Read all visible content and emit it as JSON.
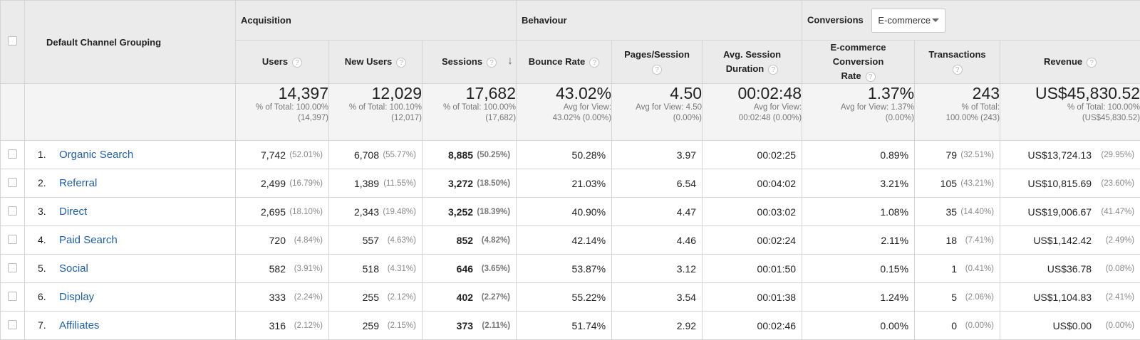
{
  "groups": {
    "dimension": "Default Channel Grouping",
    "acquisition": "Acquisition",
    "behaviour": "Behaviour",
    "conversions": "Conversions",
    "conversion_type": "E-commerce"
  },
  "columns": {
    "users": "Users",
    "new_users": "New Users",
    "sessions": "Sessions",
    "bounce_rate": "Bounce Rate",
    "pages_session": "Pages/Session",
    "avg_session_line1": "Avg. Session",
    "avg_session_line2": "Duration",
    "ecom_rate_line1": "E-commerce Conversion",
    "ecom_rate_line2": "Rate",
    "transactions": "Transactions",
    "revenue": "Revenue"
  },
  "totals": {
    "users": {
      "value": "14,397",
      "l1": "% of Total: 100.00%",
      "l2": "(14,397)"
    },
    "new_users": {
      "value": "12,029",
      "l1": "% of Total: 100.10%",
      "l2": "(12,017)"
    },
    "sessions": {
      "value": "17,682",
      "l1": "% of Total: 100.00%",
      "l2": "(17,682)"
    },
    "bounce_rate": {
      "value": "43.02%",
      "l1": "Avg for View:",
      "l2": "43.02% (0.00%)"
    },
    "pages_session": {
      "value": "4.50",
      "l1": "Avg for View: 4.50",
      "l2": "(0.00%)"
    },
    "avg_duration": {
      "value": "00:02:48",
      "l1": "Avg for View:",
      "l2": "00:02:48 (0.00%)"
    },
    "ecom_rate": {
      "value": "1.37%",
      "l1": "Avg for View: 1.37%",
      "l2": "(0.00%)"
    },
    "transactions": {
      "value": "243",
      "l1": "% of Total:",
      "l2": "100.00% (243)"
    },
    "revenue": {
      "value": "US$45,830.52",
      "l1": "% of Total: 100.00%",
      "l2": "(US$45,830.52)"
    }
  },
  "rows": [
    {
      "rank": "1.",
      "channel": "Organic Search",
      "users": "7,742",
      "users_pct": "(52.01%)",
      "new_users": "6,708",
      "new_users_pct": "(55.77%)",
      "sessions": "8,885",
      "sessions_pct": "(50.25%)",
      "bounce": "50.28%",
      "pages": "3.97",
      "duration": "00:02:25",
      "conv": "0.89%",
      "trans": "79",
      "trans_pct": "(32.51%)",
      "revenue": "US$13,724.13",
      "revenue_pct": "(29.95%)"
    },
    {
      "rank": "2.",
      "channel": "Referral",
      "users": "2,499",
      "users_pct": "(16.79%)",
      "new_users": "1,389",
      "new_users_pct": "(11.55%)",
      "sessions": "3,272",
      "sessions_pct": "(18.50%)",
      "bounce": "21.03%",
      "pages": "6.54",
      "duration": "00:04:02",
      "conv": "3.21%",
      "trans": "105",
      "trans_pct": "(43.21%)",
      "revenue": "US$10,815.69",
      "revenue_pct": "(23.60%)"
    },
    {
      "rank": "3.",
      "channel": "Direct",
      "users": "2,695",
      "users_pct": "(18.10%)",
      "new_users": "2,343",
      "new_users_pct": "(19.48%)",
      "sessions": "3,252",
      "sessions_pct": "(18.39%)",
      "bounce": "40.90%",
      "pages": "4.47",
      "duration": "00:03:02",
      "conv": "1.08%",
      "trans": "35",
      "trans_pct": "(14.40%)",
      "revenue": "US$19,006.67",
      "revenue_pct": "(41.47%)"
    },
    {
      "rank": "4.",
      "channel": "Paid Search",
      "users": "720",
      "users_pct": "(4.84%)",
      "new_users": "557",
      "new_users_pct": "(4.63%)",
      "sessions": "852",
      "sessions_pct": "(4.82%)",
      "bounce": "42.14%",
      "pages": "4.46",
      "duration": "00:02:24",
      "conv": "2.11%",
      "trans": "18",
      "trans_pct": "(7.41%)",
      "revenue": "US$1,142.42",
      "revenue_pct": "(2.49%)"
    },
    {
      "rank": "5.",
      "channel": "Social",
      "users": "582",
      "users_pct": "(3.91%)",
      "new_users": "518",
      "new_users_pct": "(4.31%)",
      "sessions": "646",
      "sessions_pct": "(3.65%)",
      "bounce": "53.87%",
      "pages": "3.12",
      "duration": "00:01:50",
      "conv": "0.15%",
      "trans": "1",
      "trans_pct": "(0.41%)",
      "revenue": "US$36.78",
      "revenue_pct": "(0.08%)"
    },
    {
      "rank": "6.",
      "channel": "Display",
      "users": "333",
      "users_pct": "(2.24%)",
      "new_users": "255",
      "new_users_pct": "(2.12%)",
      "sessions": "402",
      "sessions_pct": "(2.27%)",
      "bounce": "55.22%",
      "pages": "3.54",
      "duration": "00:01:38",
      "conv": "1.24%",
      "trans": "5",
      "trans_pct": "(2.06%)",
      "revenue": "US$1,104.83",
      "revenue_pct": "(2.41%)"
    },
    {
      "rank": "7.",
      "channel": "Affiliates",
      "users": "316",
      "users_pct": "(2.12%)",
      "new_users": "259",
      "new_users_pct": "(2.15%)",
      "sessions": "373",
      "sessions_pct": "(2.11%)",
      "bounce": "51.74%",
      "pages": "2.92",
      "duration": "00:02:46",
      "conv": "0.00%",
      "trans": "0",
      "trans_pct": "(0.00%)",
      "revenue": "US$0.00",
      "revenue_pct": "(0.00%)"
    }
  ],
  "icons": {
    "help": "question-mark-icon",
    "sort": "arrow-down-icon",
    "dropdown": "caret-down-icon"
  },
  "colors": {
    "link": "#1f5fa8",
    "header_bg": "#ebebeb",
    "totals_bg": "#f4f4f4",
    "border": "#d5d5d5"
  }
}
